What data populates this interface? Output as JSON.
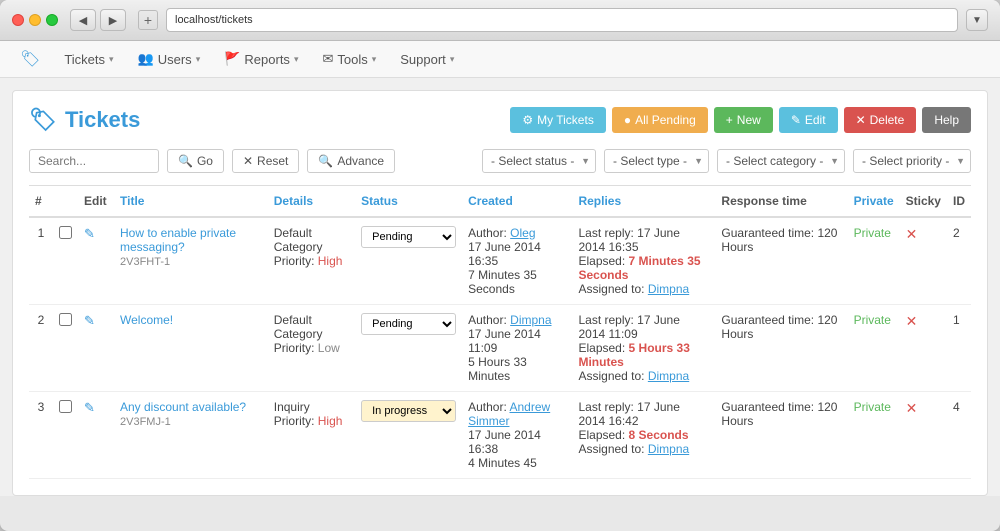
{
  "browser": {
    "tabs": [
      "localhost/tickets"
    ],
    "address": "localhost/tickets",
    "back_label": "◀",
    "forward_label": "▶",
    "new_tab_label": "+",
    "dropdown_label": "▼"
  },
  "navbar": {
    "brand_icon": "🏷",
    "items": [
      {
        "label": "Tickets",
        "has_caret": true
      },
      {
        "label": "Users",
        "has_caret": true
      },
      {
        "label": "Reports",
        "has_caret": true
      },
      {
        "label": "Tools",
        "has_caret": true
      },
      {
        "label": "Support",
        "has_caret": true
      }
    ]
  },
  "header": {
    "title": "Tickets",
    "title_icon": "🏷",
    "buttons": {
      "my_tickets": "⚙ My Tickets",
      "all_pending": "● All Pending",
      "new": "+ New",
      "edit": "✎ Edit",
      "delete": "✕ Delete",
      "help": "Help"
    }
  },
  "filters": {
    "search_placeholder": "Search...",
    "go_label": "🔍 Go",
    "reset_label": "✕ Reset",
    "advance_label": "🔍 Advance",
    "status_placeholder": "- Select status -",
    "type_placeholder": "- Select type -",
    "category_placeholder": "- Select category -",
    "priority_placeholder": "- Select priority -"
  },
  "table": {
    "columns": [
      "#",
      "",
      "Edit",
      "Title",
      "Details",
      "Status",
      "Created",
      "Replies",
      "Response time",
      "Private",
      "Sticky",
      "ID"
    ],
    "rows": [
      {
        "num": "1",
        "title": "How to enable private messaging?",
        "subtitle": "2V3FHT-1",
        "category": "Default Category",
        "priority": "High",
        "priority_class": "high",
        "status": "Pending",
        "author": "Oleg",
        "created_date": "17 June 2014",
        "created_time": "16:35",
        "created_duration": "7 Minutes 35 Seconds",
        "last_reply": "Last reply: 17 June 2014 16:35",
        "elapsed_label": "Elapsed:",
        "elapsed": "7 Minutes 35 Seconds",
        "assigned_to": "Dimpna",
        "response_time": "Guaranteed time: 120 Hours",
        "private": "Private",
        "id": "2"
      },
      {
        "num": "2",
        "title": "Welcome!",
        "subtitle": "",
        "category": "Default Category",
        "priority": "Low",
        "priority_class": "low",
        "status": "Pending",
        "author": "Dimpna",
        "created_date": "17 June 2014",
        "created_time": "11:09",
        "created_duration": "5 Hours 33 Minutes",
        "last_reply": "Last reply: 17 June 2014 11:09",
        "elapsed_label": "Elapsed:",
        "elapsed": "5 Hours 33 Minutes",
        "assigned_to": "Dimpna",
        "response_time": "Guaranteed time: 120 Hours",
        "private": "Private",
        "id": "1"
      },
      {
        "num": "3",
        "title": "Any discount available?",
        "subtitle": "2V3FMJ-1",
        "category": "Inquiry",
        "priority": "High",
        "priority_class": "high",
        "status": "In progress",
        "author": "Andrew Simmer",
        "created_date": "17 June 2014",
        "created_time": "16:38",
        "created_duration": "4 Minutes 45",
        "last_reply": "Last reply: 17 June 2014 16:42",
        "elapsed_label": "Elapsed:",
        "elapsed": "8 Seconds",
        "assigned_to": "Dimpna",
        "response_time": "Guaranteed time: 120 Hours",
        "private": "Private",
        "id": "4"
      }
    ]
  },
  "colors": {
    "blue": "#3a9ad9",
    "orange": "#f0ad4e",
    "green": "#5cb85c",
    "red": "#d9534f",
    "gray": "#777"
  }
}
